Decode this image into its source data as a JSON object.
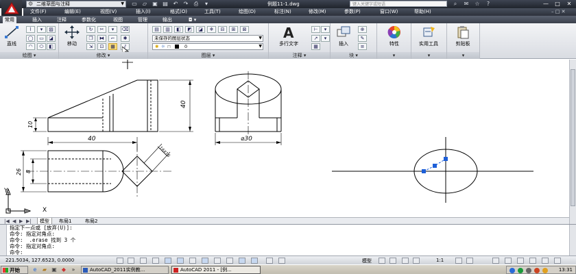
{
  "titlebar": {
    "workspace": "二维草图与注释",
    "document_title": "例题11-1.dwg",
    "search_placeholder": "键入关键字或短语",
    "window_buttons": [
      "—",
      "□",
      "✕"
    ]
  },
  "menubar": {
    "items": [
      "文件(F)",
      "编辑(E)",
      "视图(V)",
      "插入(I)",
      "格式(O)",
      "工具(T)",
      "绘图(D)",
      "标注(N)",
      "修改(M)",
      "参数(P)",
      "窗口(W)",
      "帮助(H)"
    ]
  },
  "ribbon_tabs": {
    "items": [
      "常用",
      "插入",
      "注释",
      "参数化",
      "视图",
      "管理",
      "输出"
    ]
  },
  "ribbon": {
    "draw_panel": {
      "big_label": "直线",
      "footer": "绘图 ▾"
    },
    "modify_panel": {
      "big_label": "移动",
      "footer": "修改 ▾"
    },
    "layers_panel": {
      "state_combo": "未保存的图层状态",
      "layer_combo": "0",
      "footer": "图层 ▾"
    },
    "annotation_panel": {
      "big_label": "多行文字",
      "footer": "注释 ▾"
    },
    "block_panel": {
      "big_label": "插入",
      "footer": "块 ▾"
    },
    "properties_panel": {
      "big_label": "特性"
    },
    "utilities_panel": {
      "big_label": "实用工具"
    },
    "clipboard_panel": {
      "big_label": "剪贴板"
    }
  },
  "drawing": {
    "dim_40_vertical": "40",
    "dim_10": "10",
    "dim_40_horizontal": "40",
    "dim_phi30": "⌀30",
    "dim_26": "26",
    "dim_8": "8",
    "dim_chamfer": "16X16",
    "ucs_x": "X",
    "ucs_y": "Y"
  },
  "layout_tabs": {
    "nav": [
      "|◀",
      "◀",
      "▶",
      "▶|"
    ],
    "tabs": [
      "模型",
      "布局1",
      "布局2"
    ]
  },
  "command_line": {
    "lines": [
      "指定下一点或 [放弃(U)]:",
      "命令: 指定对角点:",
      "命令:  .erase 找到 3 个",
      "命令: 指定对角点:",
      "命令:"
    ]
  },
  "statusbar": {
    "coordinates": "221.5034, 127.6523, 0.0000",
    "model_label": "模型",
    "scale_label": "1:1"
  },
  "taskbar": {
    "start_label": "开始",
    "task1": "AutoCAD_2011实例教...",
    "task2": "AutoCAD 2011 - [例...",
    "clock": "13:31"
  },
  "colors": {
    "grip_blue": "#1d5fd8",
    "title_dark": "#2a2f38",
    "ribbon_light": "#e9ebef"
  }
}
